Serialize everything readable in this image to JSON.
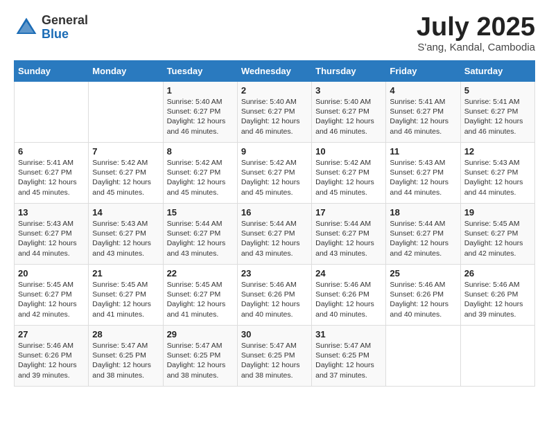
{
  "logo": {
    "general": "General",
    "blue": "Blue"
  },
  "title": "July 2025",
  "subtitle": "S'ang, Kandal, Cambodia",
  "days_of_week": [
    "Sunday",
    "Monday",
    "Tuesday",
    "Wednesday",
    "Thursday",
    "Friday",
    "Saturday"
  ],
  "weeks": [
    [
      {
        "day": "",
        "info": ""
      },
      {
        "day": "",
        "info": ""
      },
      {
        "day": "1",
        "info": "Sunrise: 5:40 AM\nSunset: 6:27 PM\nDaylight: 12 hours and 46 minutes."
      },
      {
        "day": "2",
        "info": "Sunrise: 5:40 AM\nSunset: 6:27 PM\nDaylight: 12 hours and 46 minutes."
      },
      {
        "day": "3",
        "info": "Sunrise: 5:40 AM\nSunset: 6:27 PM\nDaylight: 12 hours and 46 minutes."
      },
      {
        "day": "4",
        "info": "Sunrise: 5:41 AM\nSunset: 6:27 PM\nDaylight: 12 hours and 46 minutes."
      },
      {
        "day": "5",
        "info": "Sunrise: 5:41 AM\nSunset: 6:27 PM\nDaylight: 12 hours and 46 minutes."
      }
    ],
    [
      {
        "day": "6",
        "info": "Sunrise: 5:41 AM\nSunset: 6:27 PM\nDaylight: 12 hours and 45 minutes."
      },
      {
        "day": "7",
        "info": "Sunrise: 5:42 AM\nSunset: 6:27 PM\nDaylight: 12 hours and 45 minutes."
      },
      {
        "day": "8",
        "info": "Sunrise: 5:42 AM\nSunset: 6:27 PM\nDaylight: 12 hours and 45 minutes."
      },
      {
        "day": "9",
        "info": "Sunrise: 5:42 AM\nSunset: 6:27 PM\nDaylight: 12 hours and 45 minutes."
      },
      {
        "day": "10",
        "info": "Sunrise: 5:42 AM\nSunset: 6:27 PM\nDaylight: 12 hours and 45 minutes."
      },
      {
        "day": "11",
        "info": "Sunrise: 5:43 AM\nSunset: 6:27 PM\nDaylight: 12 hours and 44 minutes."
      },
      {
        "day": "12",
        "info": "Sunrise: 5:43 AM\nSunset: 6:27 PM\nDaylight: 12 hours and 44 minutes."
      }
    ],
    [
      {
        "day": "13",
        "info": "Sunrise: 5:43 AM\nSunset: 6:27 PM\nDaylight: 12 hours and 44 minutes."
      },
      {
        "day": "14",
        "info": "Sunrise: 5:43 AM\nSunset: 6:27 PM\nDaylight: 12 hours and 43 minutes."
      },
      {
        "day": "15",
        "info": "Sunrise: 5:44 AM\nSunset: 6:27 PM\nDaylight: 12 hours and 43 minutes."
      },
      {
        "day": "16",
        "info": "Sunrise: 5:44 AM\nSunset: 6:27 PM\nDaylight: 12 hours and 43 minutes."
      },
      {
        "day": "17",
        "info": "Sunrise: 5:44 AM\nSunset: 6:27 PM\nDaylight: 12 hours and 43 minutes."
      },
      {
        "day": "18",
        "info": "Sunrise: 5:44 AM\nSunset: 6:27 PM\nDaylight: 12 hours and 42 minutes."
      },
      {
        "day": "19",
        "info": "Sunrise: 5:45 AM\nSunset: 6:27 PM\nDaylight: 12 hours and 42 minutes."
      }
    ],
    [
      {
        "day": "20",
        "info": "Sunrise: 5:45 AM\nSunset: 6:27 PM\nDaylight: 12 hours and 42 minutes."
      },
      {
        "day": "21",
        "info": "Sunrise: 5:45 AM\nSunset: 6:27 PM\nDaylight: 12 hours and 41 minutes."
      },
      {
        "day": "22",
        "info": "Sunrise: 5:45 AM\nSunset: 6:27 PM\nDaylight: 12 hours and 41 minutes."
      },
      {
        "day": "23",
        "info": "Sunrise: 5:46 AM\nSunset: 6:26 PM\nDaylight: 12 hours and 40 minutes."
      },
      {
        "day": "24",
        "info": "Sunrise: 5:46 AM\nSunset: 6:26 PM\nDaylight: 12 hours and 40 minutes."
      },
      {
        "day": "25",
        "info": "Sunrise: 5:46 AM\nSunset: 6:26 PM\nDaylight: 12 hours and 40 minutes."
      },
      {
        "day": "26",
        "info": "Sunrise: 5:46 AM\nSunset: 6:26 PM\nDaylight: 12 hours and 39 minutes."
      }
    ],
    [
      {
        "day": "27",
        "info": "Sunrise: 5:46 AM\nSunset: 6:26 PM\nDaylight: 12 hours and 39 minutes."
      },
      {
        "day": "28",
        "info": "Sunrise: 5:47 AM\nSunset: 6:25 PM\nDaylight: 12 hours and 38 minutes."
      },
      {
        "day": "29",
        "info": "Sunrise: 5:47 AM\nSunset: 6:25 PM\nDaylight: 12 hours and 38 minutes."
      },
      {
        "day": "30",
        "info": "Sunrise: 5:47 AM\nSunset: 6:25 PM\nDaylight: 12 hours and 38 minutes."
      },
      {
        "day": "31",
        "info": "Sunrise: 5:47 AM\nSunset: 6:25 PM\nDaylight: 12 hours and 37 minutes."
      },
      {
        "day": "",
        "info": ""
      },
      {
        "day": "",
        "info": ""
      }
    ]
  ]
}
